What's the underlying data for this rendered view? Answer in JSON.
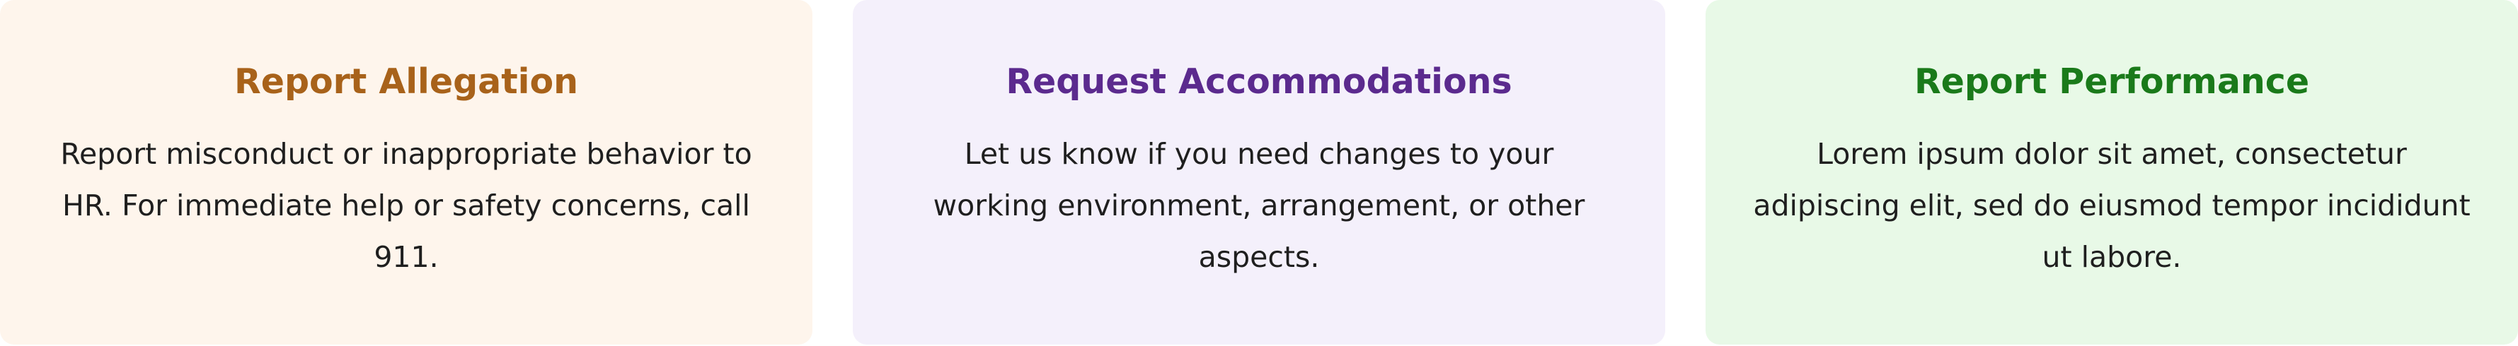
{
  "cards": [
    {
      "title": "Report Allegation",
      "description": "Report misconduct or inappropriate behavior to HR. For immediate help or safety concerns, call 911.",
      "background": "#fef5ec",
      "title_color": "#a8621a"
    },
    {
      "title": "Request Accommodations",
      "description": "Let us know if you need changes to your working environment, arrangement, or other aspects.",
      "background": "#f4f0fb",
      "title_color": "#5b2a8e"
    },
    {
      "title": "Report Performance",
      "description": "Lorem ipsum dolor sit amet, consectetur adipiscing elit, sed do eiusmod tempor incididunt ut labore.",
      "background": "#e8f9e7",
      "title_color": "#1a7a1a"
    }
  ]
}
